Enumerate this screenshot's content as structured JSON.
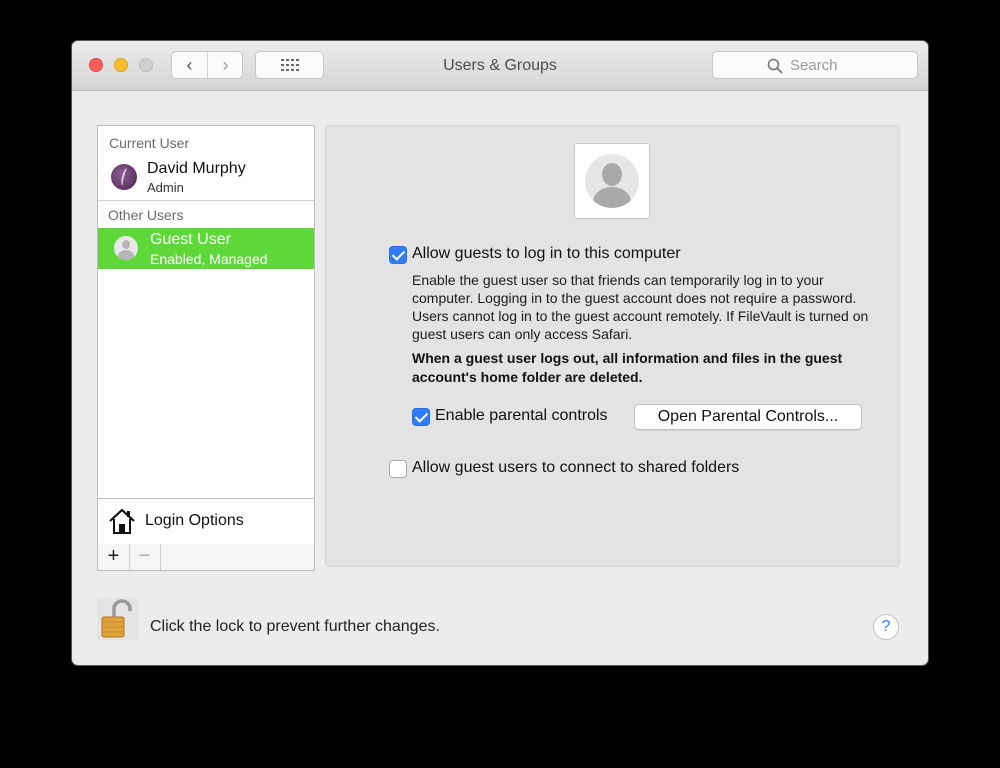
{
  "window": {
    "title": "Users & Groups",
    "search_placeholder": "Search"
  },
  "nav": {
    "back_icon": "chevron-left-icon",
    "forward_icon": "chevron-right-icon",
    "back_glyph": "‹",
    "forward_glyph": "›"
  },
  "sidebar": {
    "current_user_header": "Current User",
    "current_user": {
      "name": "David Murphy",
      "role": "Admin"
    },
    "other_users_header": "Other Users",
    "guest_user": {
      "name": "Guest User",
      "status": "Enabled, Managed"
    },
    "login_options_label": "Login Options",
    "add_label": "+",
    "remove_label": "−"
  },
  "guest_settings": {
    "allow_login": {
      "label": "Allow guests to log in to this computer",
      "checked": true
    },
    "description": "Enable the guest user so that friends can temporarily log in to your computer. Logging in to the guest account does not require a password. Users cannot log in to the guest account remotely. If FileVault is turned on guest users can only access Safari.",
    "warning": "When a guest user logs out, all information and files in the guest account's home folder are deleted.",
    "parental_controls": {
      "label": "Enable parental controls",
      "checked": true
    },
    "open_parental_button": "Open Parental Controls...",
    "shared_folders": {
      "label": "Allow guest users to connect to shared folders",
      "checked": false
    }
  },
  "footer": {
    "lock_text": "Click the lock to prevent further changes.",
    "help_label": "?"
  },
  "colors": {
    "selection": "#5dd838",
    "checkbox": "#2f7df6",
    "close": "#fc5f57",
    "minimize": "#fdbc2e"
  }
}
